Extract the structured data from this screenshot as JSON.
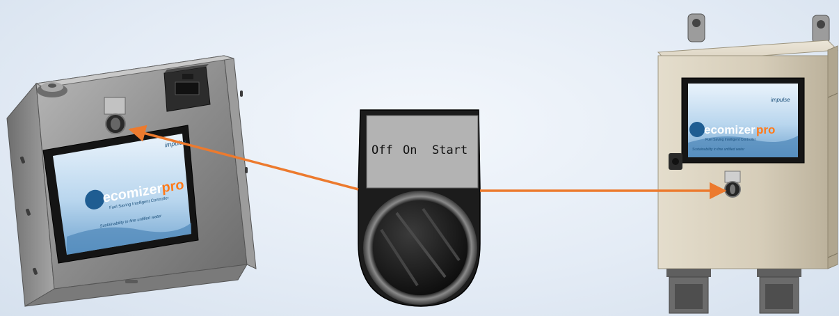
{
  "switch": {
    "positions": [
      "Off",
      "On",
      "Start"
    ]
  },
  "panel_left": {
    "screen_brand": "impulse",
    "logo_main": "ecomizer",
    "logo_accent": "pro",
    "tagline": "Fuel Saving Intelligent Controller",
    "slogan": "Sustainability in fine unfilled water"
  },
  "panel_right": {
    "screen_brand": "impulse",
    "logo_main": "ecomizer",
    "logo_accent": "pro",
    "tagline": "Fuel Saving Intelligent Controller",
    "slogan": "Sustainability in fine unfilled water"
  },
  "colors": {
    "arrow": "#ec7a2e",
    "background": "#e6edf6",
    "enclosure_beige": "#d8d0bf",
    "bracket_steel": "#8a8a8a"
  }
}
